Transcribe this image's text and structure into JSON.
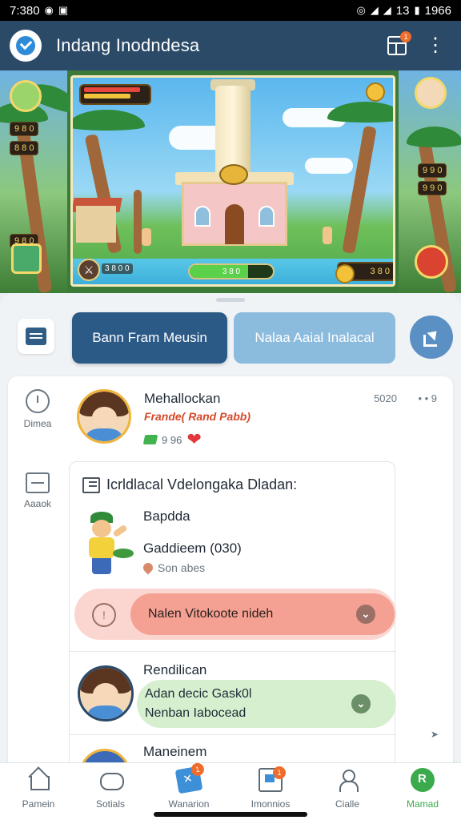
{
  "status_bar": {
    "time": "7:380",
    "right_text": "1966",
    "signal_text": "13"
  },
  "app_bar": {
    "title": "Indang Inodndesa",
    "notif_count": "1"
  },
  "game": {
    "top_badge_left_1": "9 8 0",
    "top_badge_left_2": "8 8 0",
    "side_badge_left": "9 8 0",
    "side_badge_right_1": "9 9 0",
    "side_badge_right_2": "9 9 0",
    "progress_label": "3 8 0",
    "coin_count": "3 8 0",
    "bottom_label": "3 8 0 0",
    "progress": 0.7
  },
  "actions": {
    "primary_label": "Bann Fram Meusin",
    "secondary_label": "Nalaa Aaial Inalacal"
  },
  "rail": {
    "item_1": "Dimea",
    "item_2": "Aaaok"
  },
  "post": {
    "author": "Mehallockan",
    "subtitle": "Frande( Rand Pabb)",
    "cash": "9 96",
    "time": "5020",
    "more": "• • 9"
  },
  "quest": {
    "title": "Icrldlacal Vdelongaka Dladan:",
    "name": "Bapdda",
    "meta": "Gaddieem (030)",
    "location": "Son abes",
    "alert_text": "Nalen Vitokoote nideh"
  },
  "reply": {
    "name": "Rendilican",
    "line_1": "Adan decic Gask0l",
    "line_2": "Nenban Iabocead"
  },
  "next": {
    "name": "Maneinem"
  },
  "bottom_nav": [
    {
      "label": "Pamein"
    },
    {
      "label": "Sotials"
    },
    {
      "label": "Wanarion",
      "badge": "1"
    },
    {
      "label": "Imonnios",
      "badge": "1"
    },
    {
      "label": "Cialle"
    },
    {
      "label": "Mamad"
    }
  ],
  "colors": {
    "app_bar": "#2b4a68",
    "primary_button": "#2c5a86",
    "secondary_button": "#8bbbdd",
    "alert": "#f4a193",
    "reply": "#d6f0cf",
    "active_nav": "#3aaa4c"
  }
}
